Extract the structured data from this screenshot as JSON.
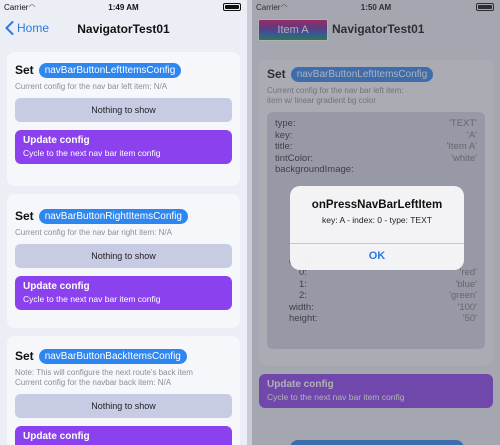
{
  "left": {
    "status": {
      "carrier": "Carrier",
      "time": "1:49 AM"
    },
    "navbar": {
      "back_label": "Home",
      "title": "NavigatorTest01"
    },
    "cards": [
      {
        "set_label": "Set",
        "pill": "navBarButtonLeftItemsConfig",
        "desc": [
          "Current config for the nav bar left item: N/A"
        ],
        "nothing": "Nothing to show",
        "update_title": "Update config",
        "update_sub": "Cycle to the next nav bar item config"
      },
      {
        "set_label": "Set",
        "pill": "navBarButtonRightItemsConfig",
        "desc": [
          "Current config for the nav bar right item: N/A"
        ],
        "nothing": "Nothing to show",
        "update_title": "Update config",
        "update_sub": "Cycle to the next nav bar item config"
      },
      {
        "set_label": "Set",
        "pill": "navBarButtonBackItemsConfig",
        "desc": [
          "Note: This will configure the next route's back item",
          "Current config for the navbar back item: N/A"
        ],
        "nothing": "Nothing to show",
        "update_title": "Update config"
      }
    ]
  },
  "right": {
    "status": {
      "carrier": "Carrier",
      "time": "1:50 AM"
    },
    "navbar": {
      "item_label": "Item A",
      "title": "NavigatorTest01"
    },
    "card": {
      "set_label": "Set",
      "pill": "navBarButtonLeftItemsConfig",
      "desc": [
        "Current config for the nav bar left item:",
        "item w/ linear gradient bg color"
      ],
      "config_rows": [
        {
          "k": "type:",
          "v": "'TEXT'",
          "indent": 0
        },
        {
          "k": "key:",
          "v": "'A'",
          "indent": 0
        },
        {
          "k": "title:",
          "v": "'Item A'",
          "indent": 0
        },
        {
          "k": "tintColor:",
          "v": "'white'",
          "indent": 0
        },
        {
          "k": "backgroundImage:",
          "v": "",
          "indent": 0
        },
        {
          "k": "",
          "v": "",
          "indent": 0
        },
        {
          "k": "",
          "v": "",
          "indent": 0
        },
        {
          "k": "",
          "v": "",
          "indent": 0
        },
        {
          "k": "",
          "v": "",
          "indent": 0
        },
        {
          "k": "",
          "v": "",
          "indent": 0
        },
        {
          "k": "",
          "v": "",
          "indent": 0
        },
        {
          "k": "",
          "v": "",
          "indent": 0
        },
        {
          "k": "colors:",
          "v": "",
          "indent": 1
        },
        {
          "k": "0:",
          "v": "'red'",
          "indent": 2
        },
        {
          "k": "1:",
          "v": "'blue'",
          "indent": 2
        },
        {
          "k": "2:",
          "v": "'green'",
          "indent": 2
        },
        {
          "k": "width:",
          "v": "'100'",
          "indent": 1
        },
        {
          "k": "height:",
          "v": "'50'",
          "indent": 1
        }
      ],
      "update_title": "Update config",
      "update_sub": "Cycle to the next nav bar item config"
    },
    "alert": {
      "title": "onPressNavBarLeftItem",
      "message": "key: A - index: 0 - type: TEXT",
      "ok_label": "OK"
    }
  },
  "colors": {
    "accent": "#2e86f0",
    "purple": "#8b42ee",
    "nothing_bg": "#c8cbe4"
  }
}
